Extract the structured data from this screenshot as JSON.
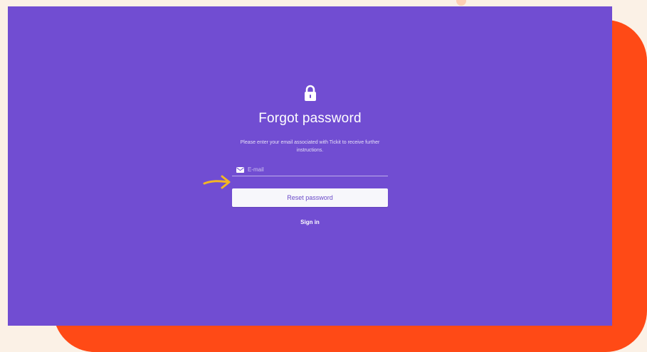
{
  "page": {
    "title": "Forgot password",
    "subtitle": "Please enter your email associated with Tickit to receive further instructions."
  },
  "form": {
    "email_placeholder": "E-mail",
    "email_value": "",
    "reset_label": "Reset password",
    "signin_label": "Sign in"
  },
  "icons": {
    "lock": "lock-icon",
    "mail": "mail-icon",
    "pointer": "arrow-right-icon"
  },
  "colors": {
    "page_background": "#fbf1e6",
    "backdrop": "#ff4a16",
    "screen": "#714dd2",
    "button": "#f7f7fb",
    "button_text": "#6a4ac8",
    "annotation_arrow": "#f3b624"
  }
}
